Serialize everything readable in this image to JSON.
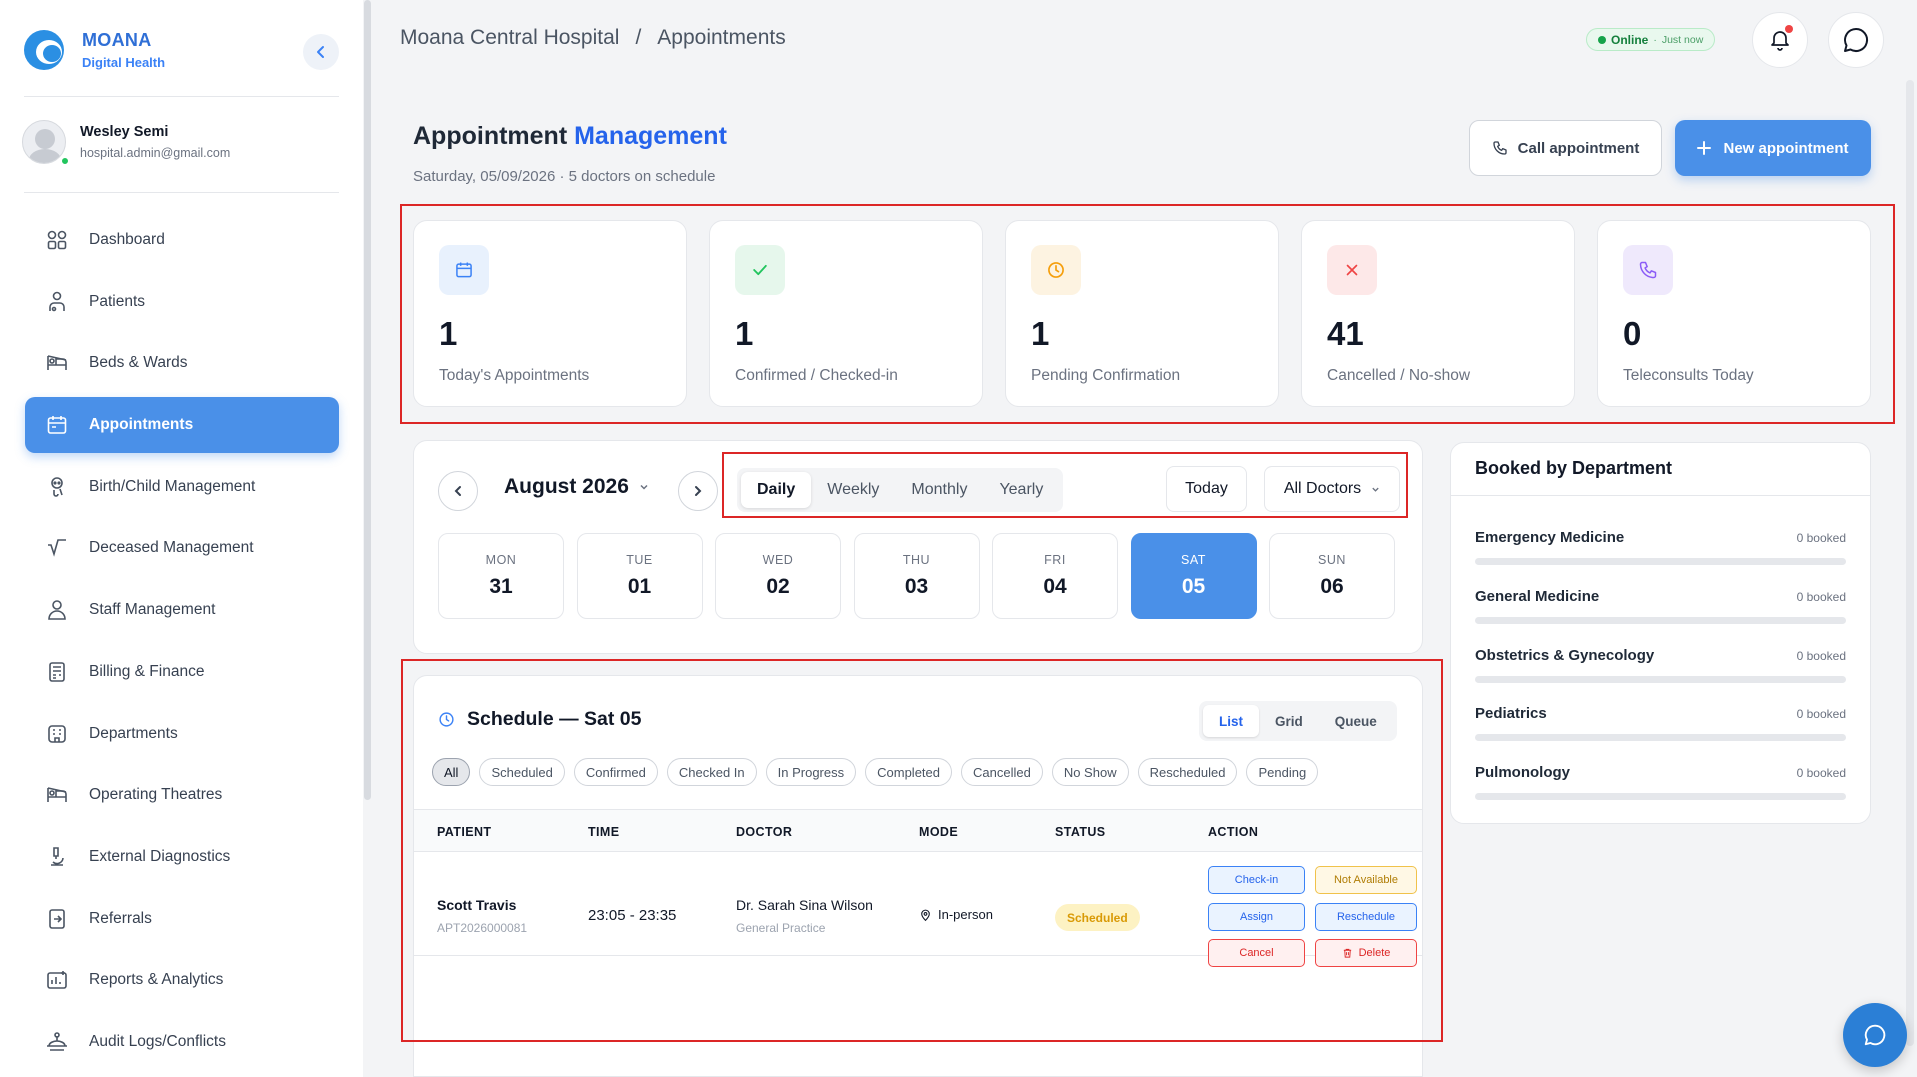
{
  "brand": {
    "name": "MOANA",
    "subtitle": "Digital Health"
  },
  "user": {
    "name": "Wesley Semi",
    "email": "hospital.admin@gmail.com"
  },
  "nav": [
    {
      "label": "Dashboard",
      "icon": "dashboard-icon"
    },
    {
      "label": "Patients",
      "icon": "patients-icon"
    },
    {
      "label": "Beds & Wards",
      "icon": "beds-icon"
    },
    {
      "label": "Appointments",
      "icon": "calendar-icon",
      "active": true
    },
    {
      "label": "Birth/Child Management",
      "icon": "baby-icon"
    },
    {
      "label": "Deceased Management",
      "icon": "deceased-icon"
    },
    {
      "label": "Staff Management",
      "icon": "staff-icon"
    },
    {
      "label": "Billing & Finance",
      "icon": "billing-icon"
    },
    {
      "label": "Departments",
      "icon": "departments-icon"
    },
    {
      "label": "Operating Theatres",
      "icon": "theatre-icon"
    },
    {
      "label": "External Diagnostics",
      "icon": "microscope-icon"
    },
    {
      "label": "Referrals",
      "icon": "referral-icon"
    },
    {
      "label": "Reports & Analytics",
      "icon": "reports-icon"
    },
    {
      "label": "Audit Logs/Conflicts",
      "icon": "audit-icon"
    }
  ],
  "breadcrumb": {
    "hospital": "Moana Central Hospital",
    "sep": "/",
    "page": "Appointments"
  },
  "status": {
    "label": "Online",
    "sep": "·",
    "ago": "Just now"
  },
  "header": {
    "title_main": "Appointment",
    "title_accent": "Management",
    "subtitle": "Saturday, 05/09/2026 · 5 doctors on schedule",
    "call_label": "Call appointment",
    "new_label": "New appointment"
  },
  "stats": [
    {
      "value": "1",
      "label": "Today's Appointments",
      "icon": "calendar-icon",
      "color": "#3b82f6"
    },
    {
      "value": "1",
      "label": "Confirmed / Checked-in",
      "icon": "check-icon",
      "color": "#22c55e"
    },
    {
      "value": "1",
      "label": "Pending Confirmation",
      "icon": "clock-icon",
      "color": "#f59e0b"
    },
    {
      "value": "41",
      "label": "Cancelled / No-show",
      "icon": "x-icon",
      "color": "#ef4444"
    },
    {
      "value": "0",
      "label": "Teleconsults Today",
      "icon": "phone-icon",
      "color": "#8b5cf6"
    }
  ],
  "calendar": {
    "month": "August 2026",
    "views": [
      "Daily",
      "Weekly",
      "Monthly",
      "Yearly"
    ],
    "active_view": "Daily",
    "today_label": "Today",
    "doctor_filter": "All Doctors",
    "days": [
      {
        "name": "MON",
        "date": "31"
      },
      {
        "name": "TUE",
        "date": "01"
      },
      {
        "name": "WED",
        "date": "02"
      },
      {
        "name": "THU",
        "date": "03"
      },
      {
        "name": "FRI",
        "date": "04"
      },
      {
        "name": "SAT",
        "date": "05",
        "active": true
      },
      {
        "name": "SUN",
        "date": "06"
      }
    ]
  },
  "schedule": {
    "title": "Schedule — Sat 05",
    "views": [
      "List",
      "Grid",
      "Queue"
    ],
    "filters": [
      "All",
      "Scheduled",
      "Confirmed",
      "Checked In",
      "In Progress",
      "Completed",
      "Cancelled",
      "No Show",
      "Rescheduled",
      "Pending"
    ],
    "columns": [
      "PATIENT",
      "TIME",
      "DOCTOR",
      "MODE",
      "STATUS",
      "ACTION"
    ],
    "rows": [
      {
        "patient": "Scott Travis",
        "id": "APT2026000081",
        "time": "23:05 - 23:35",
        "doctor": "Dr. Sarah Sina Wilson",
        "specialty": "General Practice",
        "mode": "In-person",
        "status": "Scheduled",
        "actions": {
          "checkin": "Check-in",
          "not_available": "Not Available",
          "assign": "Assign",
          "reschedule": "Reschedule",
          "cancel": "Cancel",
          "delete": "Delete"
        }
      }
    ]
  },
  "departments": {
    "title": "Booked by Department",
    "items": [
      {
        "name": "Emergency Medicine",
        "count": "0 booked",
        "fill": 0
      },
      {
        "name": "General Medicine",
        "count": "0 booked",
        "fill": 0
      },
      {
        "name": "Obstetrics & Gynecology",
        "count": "0 booked",
        "fill": 0
      },
      {
        "name": "Pediatrics",
        "count": "0 booked",
        "fill": 0
      },
      {
        "name": "Pulmonology",
        "count": "0 booked",
        "fill": 0
      }
    ]
  }
}
